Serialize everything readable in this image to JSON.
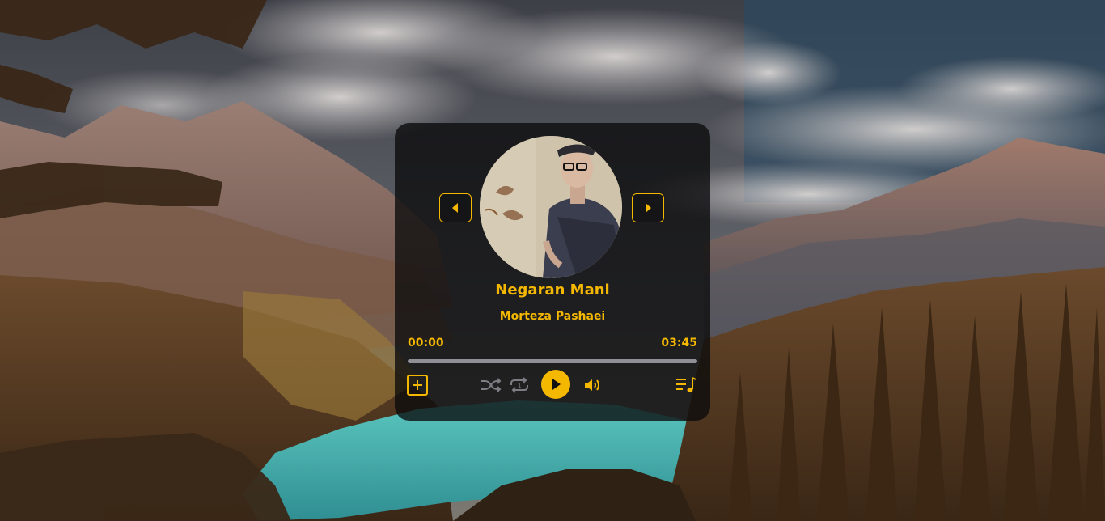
{
  "track": {
    "title": "Negaran Mani",
    "artist": "Morteza Pashaei",
    "current_time": "00:00",
    "duration": "03:45",
    "progress": 0
  },
  "controls": {
    "prev": "caret-left-icon",
    "next": "caret-right-icon",
    "add": "plus-square-icon",
    "shuffle": "shuffle-icon",
    "repeat": "repeat-icon",
    "play": "play-icon",
    "volume": "volume-icon",
    "playlist": "playlist-music-icon"
  },
  "colors": {
    "accent": "#f5b800",
    "card_background": "#0a0a0c",
    "progress_track": "#8f8f95"
  }
}
